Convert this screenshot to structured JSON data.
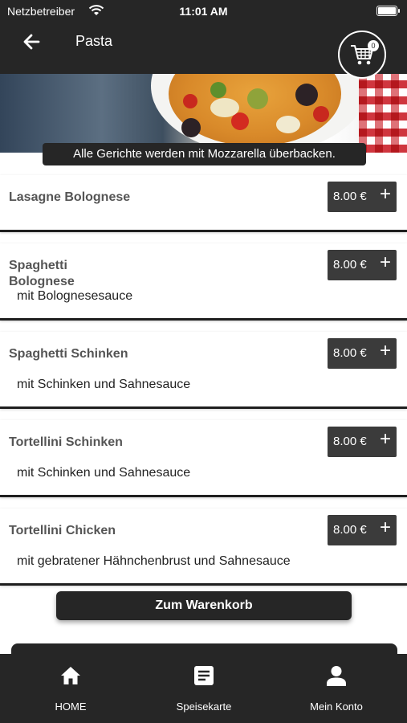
{
  "status_bar": {
    "carrier": "Netzbetreiber",
    "time": "11:01 AM"
  },
  "header": {
    "title": "Pasta",
    "back_icon": "arrow-left-icon",
    "cart_icon": "shopping-cart-icon",
    "cart_count": "0"
  },
  "hero": {
    "banner": "Alle Gerichte werden mit Mozzarella überbacken."
  },
  "menu_items": [
    {
      "name": "Lasagne Bolognese",
      "description": "",
      "price": "8.00 €"
    },
    {
      "name": "Spaghetti Bolognese",
      "description": "mit Bolognesesauce",
      "price": "8.00 €"
    },
    {
      "name": "Spaghetti Schinken",
      "description": "mit Schinken und Sahnesauce",
      "price": "8.00 €"
    },
    {
      "name": "Tortellini Schinken",
      "description": "mit Schinken und Sahnesauce",
      "price": "8.00 €"
    },
    {
      "name": "Tortellini Chicken",
      "description": "mit gebratener Hähnchenbrust und Sahnesauce",
      "price": "8.00 €"
    }
  ],
  "add_symbol": "+",
  "to_cart_label": "Zum Warenkorb",
  "tabs": [
    {
      "label": "HOME",
      "icon": "home-icon"
    },
    {
      "label": "Speisekarte",
      "icon": "menu-list-icon"
    },
    {
      "label": "Mein Konto",
      "icon": "user-icon"
    }
  ],
  "colors": {
    "dark": "#262626",
    "price_button": "#3b3b3b",
    "item_name": "#555555"
  }
}
